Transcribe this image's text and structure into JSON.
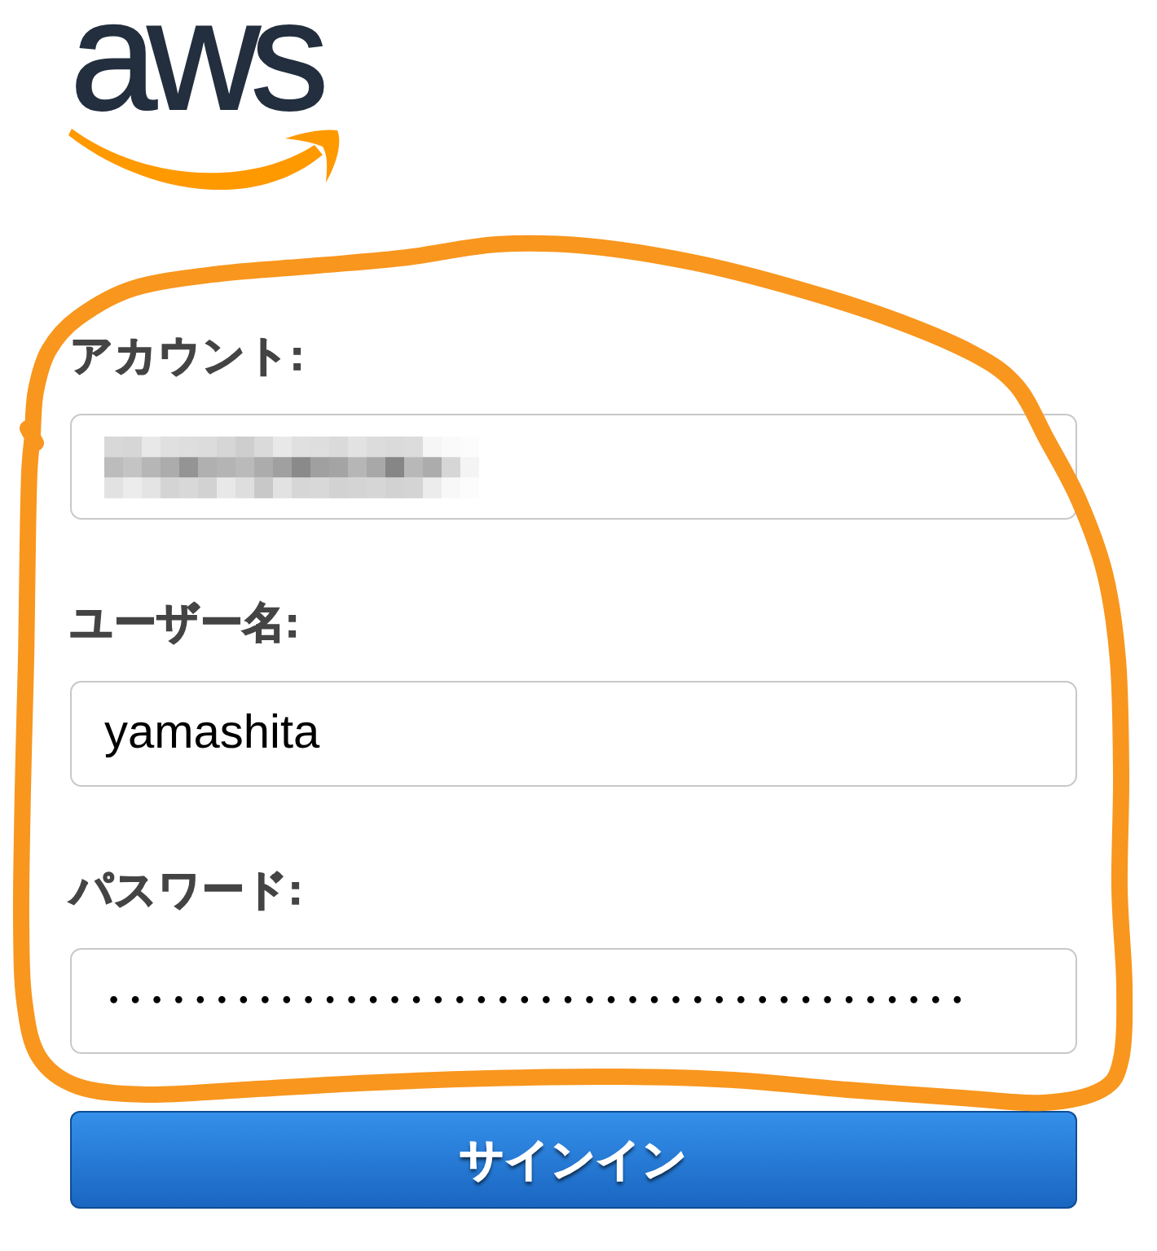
{
  "logo": {
    "text": "aws"
  },
  "fields": [
    {
      "label": "アカウント:",
      "kind": "redacted"
    },
    {
      "label": "ユーザー名:",
      "kind": "text",
      "value": "yamashita"
    },
    {
      "label": "パスワード:",
      "kind": "masked",
      "value": "••••••••••••••••••••••••••••••••••••••••"
    }
  ],
  "sign_in_button": {
    "label": "サインイン"
  },
  "annotation": {
    "kind": "freehand-loop"
  }
}
